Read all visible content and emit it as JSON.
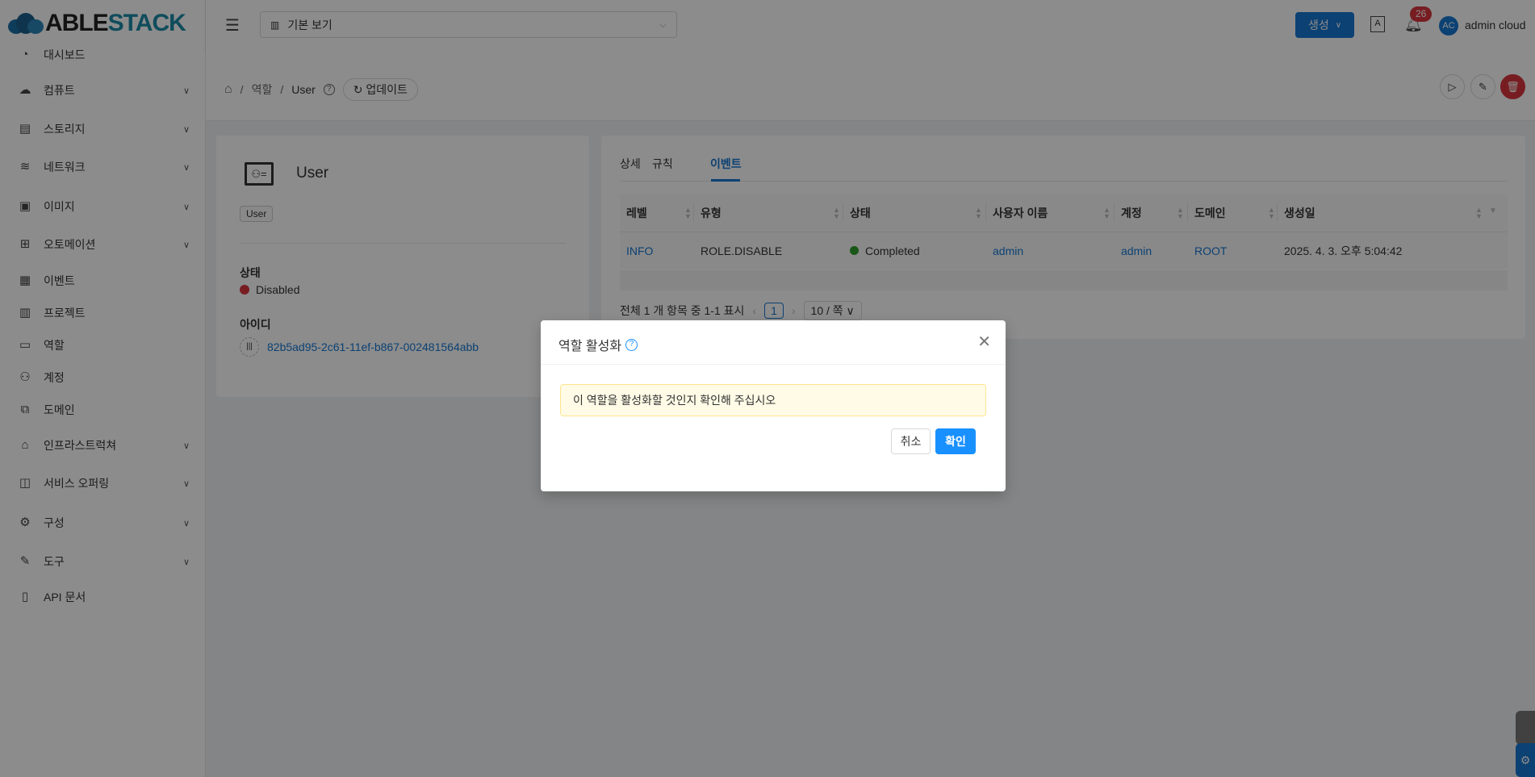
{
  "app": {
    "logo_a": "ABLE",
    "logo_b": "STACK"
  },
  "header": {
    "view_select": "기본 보기",
    "create_label": "생성",
    "notifications": "26",
    "avatar_initials": "AC",
    "user_name": "admin cloud"
  },
  "sidebar": {
    "items": [
      {
        "label": "대시보드",
        "icon": "dashboard-icon",
        "chevron": false
      },
      {
        "label": "컴퓨트",
        "icon": "cloud-icon",
        "chevron": true
      },
      {
        "label": "스토리지",
        "icon": "storage-icon",
        "chevron": true
      },
      {
        "label": "네트워크",
        "icon": "wifi-icon",
        "chevron": true
      },
      {
        "label": "이미지",
        "icon": "picture-icon",
        "chevron": true
      },
      {
        "label": "오토메이션",
        "icon": "apps-icon",
        "chevron": true
      },
      {
        "label": "이벤트",
        "icon": "calendar-icon",
        "chevron": false
      },
      {
        "label": "프로젝트",
        "icon": "project-icon",
        "chevron": false
      },
      {
        "label": "역할",
        "icon": "idcard-icon",
        "chevron": false
      },
      {
        "label": "계정",
        "icon": "team-icon",
        "chevron": false
      },
      {
        "label": "도메인",
        "icon": "block-icon",
        "chevron": false
      },
      {
        "label": "인프라스트럭쳐",
        "icon": "bank-icon",
        "chevron": true
      },
      {
        "label": "서비스 오퍼링",
        "icon": "shopping-icon",
        "chevron": true
      },
      {
        "label": "구성",
        "icon": "setting-icon",
        "chevron": true
      },
      {
        "label": "도구",
        "icon": "tool-icon",
        "chevron": true
      },
      {
        "label": "API 문서",
        "icon": "read-icon",
        "chevron": false
      }
    ]
  },
  "breadcrumb": {
    "items": [
      "역할",
      "User"
    ],
    "refresh_label": "업데이트"
  },
  "detail": {
    "name": "User",
    "tag": "User",
    "status_label": "상태",
    "status_value": "Disabled",
    "id_label": "아이디",
    "id_value": "82b5ad95-2c61-11ef-b867-002481564abb"
  },
  "tabs": [
    "상세",
    "규칙",
    "이벤트"
  ],
  "active_tab": "이벤트",
  "table": {
    "columns": [
      "레벨",
      "유형",
      "상태",
      "사용자 이름",
      "계정",
      "도메인",
      "생성일"
    ],
    "rows": [
      {
        "level": "INFO",
        "type": "ROLE.DISABLE",
        "state": "Completed",
        "username": "admin",
        "account": "admin",
        "domain": "ROOT",
        "created": "2025. 4. 3. 오후 5:04:42"
      }
    ]
  },
  "pagination": {
    "summary": "전체 1 개 항목 중 1-1 표시",
    "page": "1",
    "page_size": "10 / 쪽"
  },
  "modal": {
    "title": "역할 활성화",
    "message": "이 역할을 활성화할 것인지 확인해 주십시오",
    "cancel": "취소",
    "ok": "확인"
  },
  "colors": {
    "primary": "#1677d2",
    "danger": "#d9363e",
    "success": "#2e9e2e"
  }
}
